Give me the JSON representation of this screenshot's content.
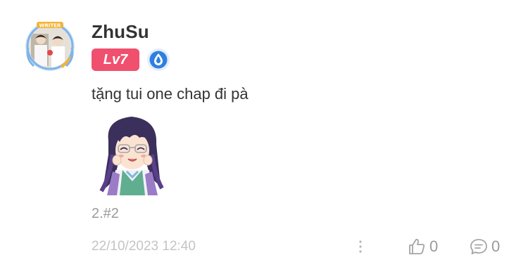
{
  "comment": {
    "username": "ZhuSu",
    "level_badge": "Lv7",
    "rank_icon": "water-drop-rank-icon",
    "text": "tặng tui one chap đi pà",
    "sticker": "anime-girl-sticker",
    "chapter_ref": "2.#2",
    "timestamp": "22/10/2023 12:40",
    "likes": "0",
    "replies": "0"
  },
  "colors": {
    "level_badge_bg": "#f0506e",
    "rank_icon": "#2f7fe0",
    "muted_text": "#9a9a9a",
    "timestamp_text": "#c4c4c4"
  }
}
